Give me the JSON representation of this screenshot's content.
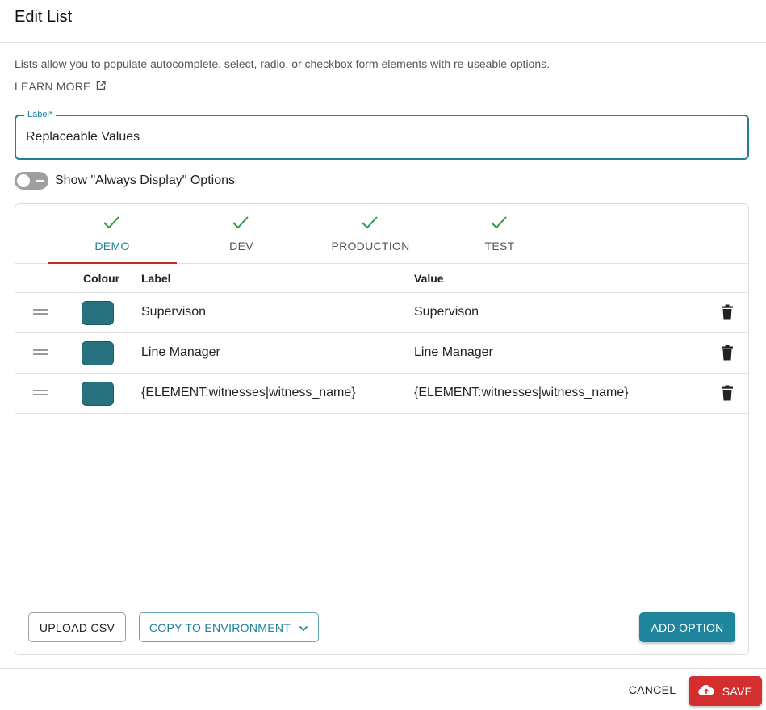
{
  "dialog": {
    "title": "Edit List",
    "description": "Lists allow you to populate autocomplete, select, radio, or checkbox form elements with re-useable options.",
    "learn_more": "LEARN MORE"
  },
  "label_field": {
    "floating_label": "Label*",
    "value": "Replaceable Values"
  },
  "toggle": {
    "label": "Show \"Always Display\" Options",
    "checked": false
  },
  "tabs": [
    {
      "label": "DEMO",
      "complete": true,
      "active": true
    },
    {
      "label": "DEV",
      "complete": true,
      "active": false
    },
    {
      "label": "PRODUCTION",
      "complete": true,
      "active": false
    },
    {
      "label": "TEST",
      "complete": true,
      "active": false
    }
  ],
  "table": {
    "headers": {
      "colour": "Colour",
      "label": "Label",
      "value": "Value"
    },
    "rows": [
      {
        "colour": "#26737f",
        "label": "Supervison",
        "value": "Supervison"
      },
      {
        "colour": "#26737f",
        "label": "Line Manager",
        "value": "Line Manager"
      },
      {
        "colour": "#26737f",
        "label": "{ELEMENT:witnesses|witness_name}",
        "value": "{ELEMENT:witnesses|witness_name}"
      }
    ]
  },
  "actions": {
    "upload_csv": "UPLOAD CSV",
    "copy_to_environment": "COPY TO ENVIRONMENT",
    "add_option": "ADD OPTION"
  },
  "footer": {
    "cancel": "CANCEL",
    "save": "SAVE"
  },
  "colors": {
    "primary": "#1f7f95",
    "danger": "#d32f2f",
    "success": "#2e9c4a"
  }
}
